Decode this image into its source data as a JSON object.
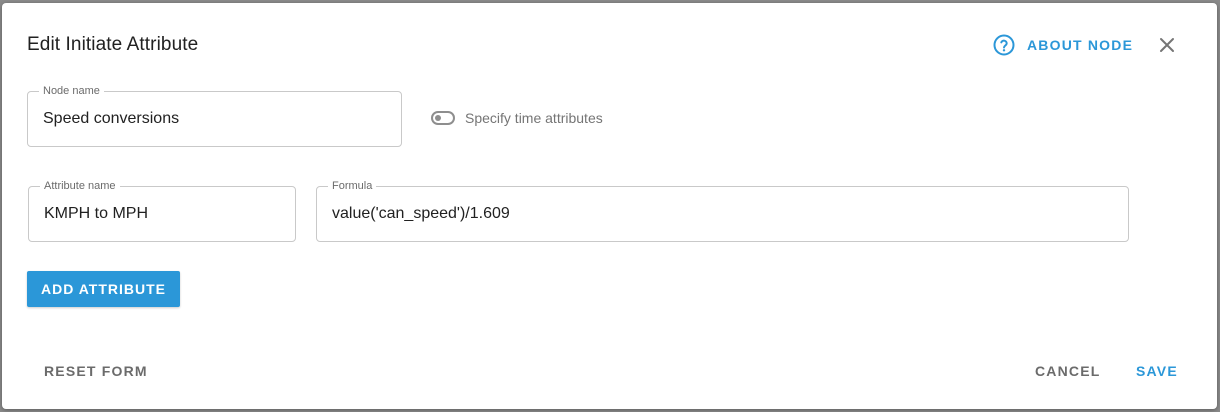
{
  "dialog": {
    "title": "Edit Initiate Attribute",
    "about_label": "ABOUT NODE",
    "about_icon": "help-circle-icon",
    "close_icon": "close-icon"
  },
  "node_name": {
    "label": "Node name",
    "value": "Speed conversions"
  },
  "time_toggle": {
    "label": "Specify time attributes",
    "checked": false
  },
  "attribute": {
    "name_label": "Attribute name",
    "name_value": "KMPH to MPH",
    "formula_label": "Formula",
    "formula_value": "value('can_speed')/1.609"
  },
  "actions": {
    "add_attribute": "ADD ATTRIBUTE",
    "reset_form": "RESET FORM",
    "cancel": "CANCEL",
    "save": "SAVE"
  },
  "colors": {
    "accent": "#2b97d8",
    "muted_text": "#6b6b6b",
    "border": "#c9c9c9"
  }
}
